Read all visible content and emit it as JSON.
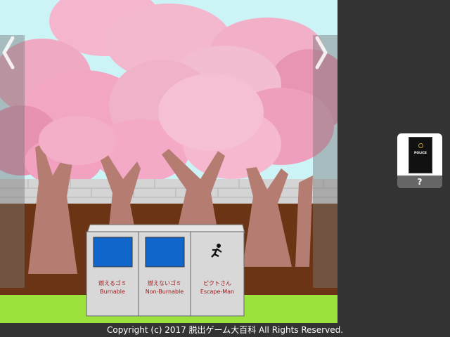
{
  "scene": {
    "bins": [
      {
        "label_ja": "燃えるゴミ",
        "label_en": "Burnable",
        "slot_color": "#1166cc"
      },
      {
        "label_ja": "燃えないゴミ",
        "label_en": "Non-Burnable",
        "slot_color": "#1166cc"
      },
      {
        "label_ja": "ピクトさん",
        "label_en": "Escape-Man",
        "icon": "running-man-icon"
      }
    ],
    "nav": {
      "left_icon": "chevron-left-icon",
      "right_icon": "chevron-right-icon"
    }
  },
  "inventory": {
    "item_icon": "police-notebook-icon",
    "item_text": "POLICE",
    "help_label": "?"
  },
  "footer": {
    "copyright": "Copyright (c) 2017 脱出ゲーム大百科 All Rights Reserved."
  },
  "colors": {
    "sky": "#ccf4f7",
    "blossom": "#f2b6cc",
    "bark": "#b57c72",
    "soil": "#6b3515",
    "grass": "#9be23c",
    "sidebar": "#333333",
    "bin_label": "#a01818"
  }
}
